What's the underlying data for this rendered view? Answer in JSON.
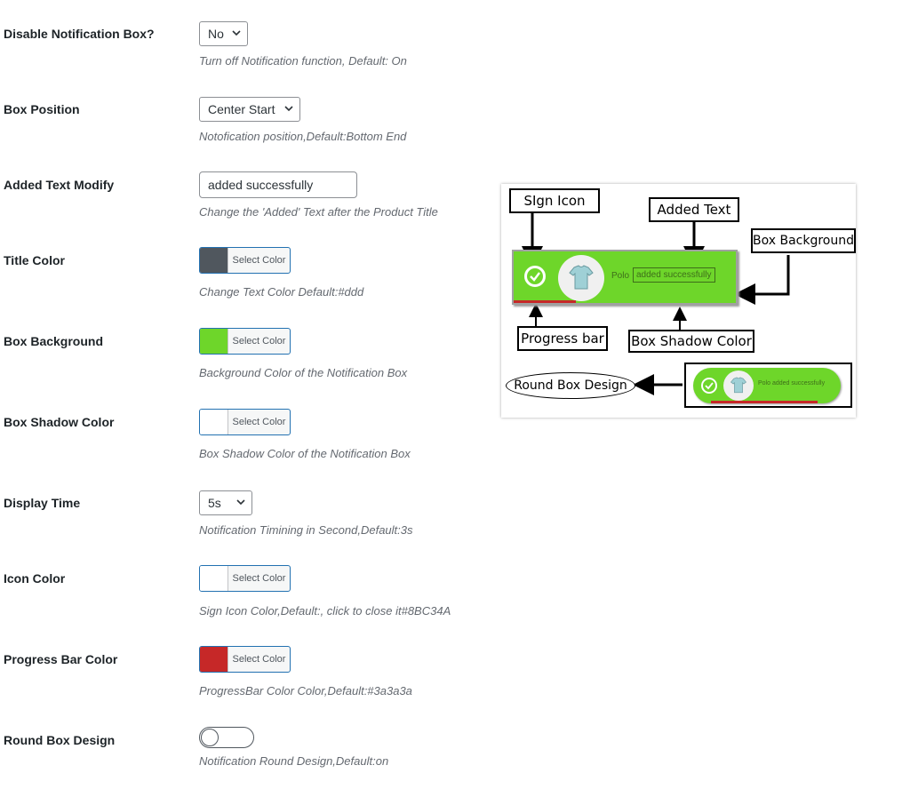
{
  "settings": [
    {
      "label": "Disable Notification Box?",
      "value": "No",
      "description": "Turn off Notification function, Default: On"
    },
    {
      "label": "Box Position",
      "value": "Center Start",
      "description": "Notofication position,Default:Bottom End"
    },
    {
      "label": "Added Text Modify",
      "value": "added successfully",
      "description": "Change the 'Added' Text after the Product Title"
    },
    {
      "label": "Title Color",
      "button": "Select Color",
      "swatch": "#50575e",
      "description": "Change Text Color Default:#ddd"
    },
    {
      "label": "Box Background",
      "button": "Select Color",
      "swatch": "#6ed62a",
      "description": "Background Color of the Notification Box"
    },
    {
      "label": "Box Shadow Color",
      "button": "Select Color",
      "swatch": "#ffffff",
      "description": "Box Shadow Color of the Notification Box"
    },
    {
      "label": "Display Time",
      "value": "5s",
      "description": "Notification Timining in Second,Default:3s"
    },
    {
      "label": "Icon Color",
      "button": "Select Color",
      "swatch": "#ffffff",
      "description": "Sign Icon Color,Default:, click to close it#8BC34A"
    },
    {
      "label": "Progress Bar Color",
      "button": "Select Color",
      "swatch": "#c62828",
      "description": "ProgressBar Color Color,Default:#3a3a3a"
    },
    {
      "label": "Round Box Design",
      "toggle": false,
      "description": "Notification Round Design,Default:on"
    }
  ],
  "preview": {
    "callouts": {
      "sign_icon": "SIgn Icon",
      "added_text": "Added Text",
      "box_background": "Box Background",
      "progress_bar": "Progress bar",
      "box_shadow_color": "Box Shadow Color",
      "round_box_design": "Round Box Design"
    },
    "notification": {
      "title": "Polo",
      "added": "added successfully",
      "round_text": "Polo added successfully"
    },
    "colors": {
      "green": "#6ed62a",
      "red": "#c62828"
    }
  }
}
